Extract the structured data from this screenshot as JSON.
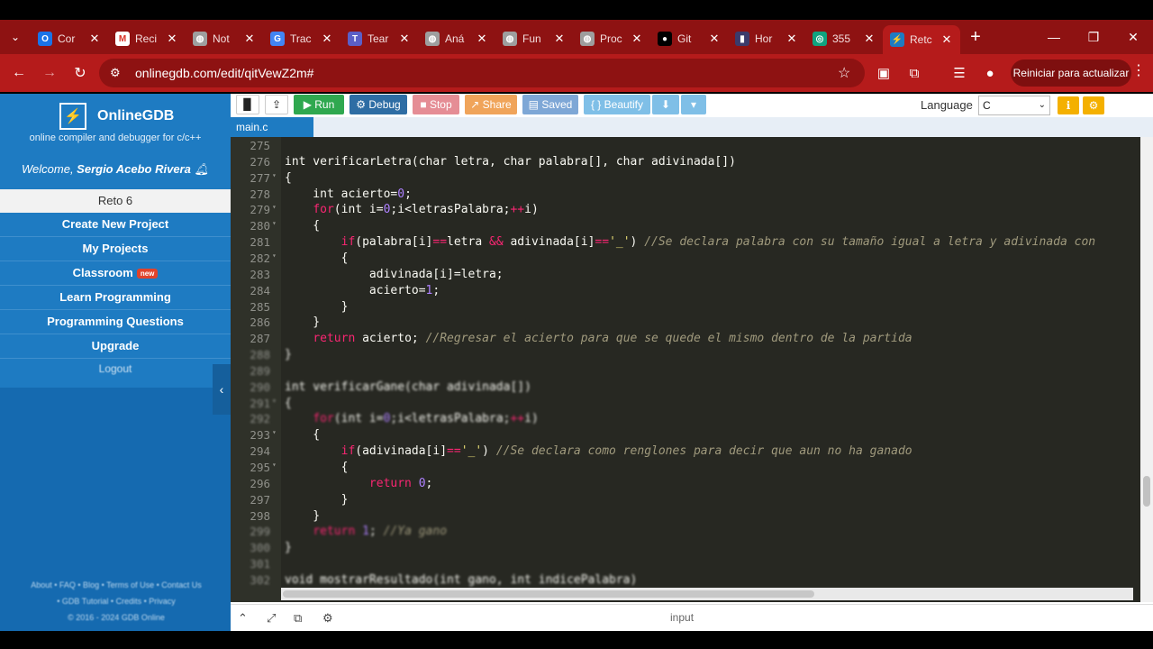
{
  "browser": {
    "tabs": [
      {
        "label": "Cor",
        "icon": "outlook-icon",
        "color": "#1a73e8",
        "glyph": "O"
      },
      {
        "label": "Reci",
        "icon": "gmail-icon",
        "color": "#ffffff",
        "glyph": "M"
      },
      {
        "label": "Not",
        "icon": "globe-icon",
        "color": "#9e9e9e",
        "glyph": "◍"
      },
      {
        "label": "Trac",
        "icon": "translate-icon",
        "color": "#4285f4",
        "glyph": "G"
      },
      {
        "label": "Tear",
        "icon": "teams-icon",
        "color": "#5b5fc7",
        "glyph": "T"
      },
      {
        "label": "Aná",
        "icon": "globe-icon",
        "color": "#9e9e9e",
        "glyph": "◍"
      },
      {
        "label": "Fun",
        "icon": "globe-icon",
        "color": "#9e9e9e",
        "glyph": "◍"
      },
      {
        "label": "Proc",
        "icon": "globe-icon",
        "color": "#9e9e9e",
        "glyph": "◍"
      },
      {
        "label": "Git",
        "icon": "github-icon",
        "color": "#000000",
        "glyph": "●"
      },
      {
        "label": "Hor",
        "icon": "page-icon",
        "color": "#3b3b6b",
        "glyph": "▮"
      },
      {
        "label": "355",
        "icon": "chatgpt-icon",
        "color": "#10a37f",
        "glyph": "◎"
      },
      {
        "label": "Retc",
        "icon": "onlinegdb-icon",
        "color": "#1e7bc2",
        "glyph": "⚡"
      }
    ],
    "url": "onlinegdb.com/edit/qitVewZ2m#",
    "relaunch_label": "Reiniciar para actualizar"
  },
  "sidebar": {
    "brand": "OnlineGDB",
    "tagline": "online compiler and debugger for c/c++",
    "welcome_prefix": "Welcome, ",
    "user": "Sergio Acebo Rivera",
    "project": "Reto 6",
    "menu": [
      "Create New Project",
      "My Projects",
      "Classroom",
      "Learn Programming",
      "Programming Questions",
      "Upgrade"
    ],
    "new_badge": "new",
    "logout": "Logout",
    "footer": [
      "About • FAQ • Blog • Terms of Use • Contact Us",
      "• GDB Tutorial • Credits • Privacy",
      "© 2016 - 2024 GDB Online"
    ]
  },
  "toolbar": {
    "run": "Run",
    "debug": "Debug",
    "stop": "Stop",
    "share": "Share",
    "saved": "Saved",
    "beautify": "{ } Beautify",
    "language_label": "Language",
    "language_value": "C"
  },
  "file_tab": "main.c",
  "io_label": "input",
  "code_lines": [
    {
      "n": "275",
      "html": ""
    },
    {
      "n": "276",
      "html": "int verificarLetra(char letra, char palabra[], char adivinada[])"
    },
    {
      "n": "277",
      "html": "{"
    },
    {
      "n": "278",
      "html": "    int acierto=<span class=\"num\">0</span>;"
    },
    {
      "n": "279",
      "html": "    <span class=\"kw\">for</span>(int i=<span class=\"num\">0</span>;i&lt;letrasPalabra;<span class=\"kw\">++</span>i)"
    },
    {
      "n": "280",
      "html": "    {"
    },
    {
      "n": "281",
      "html": "        <span class=\"kw\">if</span>(palabra[i]<span class=\"kw\">==</span>letra <span class=\"kw\">&amp;&amp;</span> adivinada[i]<span class=\"kw\">==</span><span class=\"str\">'_'</span>) <span class=\"cm\">//Se declara palabra con su tamaño igual a letra y adivinada con</span>"
    },
    {
      "n": "282",
      "html": "        {"
    },
    {
      "n": "283",
      "html": "            adivinada[i]=letra;"
    },
    {
      "n": "284",
      "html": "            acierto=<span class=\"num\">1</span>;"
    },
    {
      "n": "285",
      "html": "        }"
    },
    {
      "n": "286",
      "html": "    }"
    },
    {
      "n": "287",
      "html": "    <span class=\"kw\">return</span> acierto; <span class=\"cm\">//Regresar el acierto para que se quede el mismo dentro de la partida</span>"
    },
    {
      "n": "288",
      "html": "}"
    },
    {
      "n": "289",
      "html": ""
    },
    {
      "n": "290",
      "html": "int verificarGane(char adivinada[])"
    },
    {
      "n": "291",
      "html": "{"
    },
    {
      "n": "292",
      "html": "    <span class=\"kw\">for</span>(int i=<span class=\"num\">0</span>;i&lt;letrasPalabra;<span class=\"kw\">++</span>i)"
    },
    {
      "n": "293",
      "html": "    {"
    },
    {
      "n": "294",
      "html": "        <span class=\"kw\">if</span>(adivinada[i]<span class=\"kw\">==</span><span class=\"str\">'_'</span>) <span class=\"cm\">//Se declara como renglones para decir que aun no ha ganado</span>"
    },
    {
      "n": "295",
      "html": "        {"
    },
    {
      "n": "296",
      "html": "            <span class=\"kw\">return</span> <span class=\"num\">0</span>;"
    },
    {
      "n": "297",
      "html": "        }"
    },
    {
      "n": "298",
      "html": "    }"
    },
    {
      "n": "299",
      "html": "    <span class=\"kw\">return</span> <span class=\"num\">1</span>; <span class=\"cm\">//Ya gano</span>"
    },
    {
      "n": "300",
      "html": "}"
    },
    {
      "n": "301",
      "html": ""
    },
    {
      "n": "302",
      "html": "void mostrarResultado(int gano, int indicePalabra)"
    }
  ]
}
